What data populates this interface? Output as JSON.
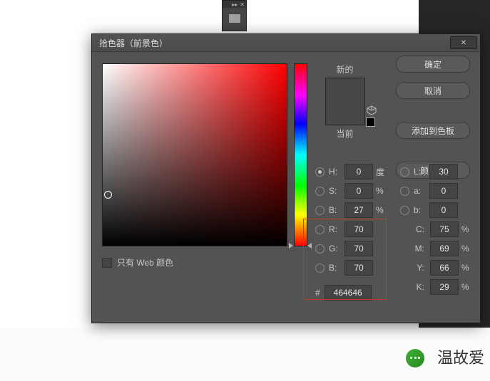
{
  "title": "拾色器（前景色）",
  "buttons": {
    "ok": "确定",
    "cancel": "取消",
    "add_swatch": "添加到色板",
    "library": "颜色库"
  },
  "labels": {
    "new": "新的",
    "current": "当前",
    "web_only": "只有 Web 颜色",
    "hash": "#"
  },
  "units": {
    "deg": "度",
    "pct": "%"
  },
  "hsb": {
    "h_label": "H:",
    "s_label": "S:",
    "b_label": "B:",
    "h": "0",
    "s": "0",
    "b": "27"
  },
  "lab": {
    "l_label": "L:",
    "a_label": "a:",
    "b_label": "b:",
    "l": "30",
    "a": "0",
    "b": "0"
  },
  "rgb": {
    "r_label": "R:",
    "g_label": "G:",
    "b_label": "B:",
    "r": "70",
    "g": "70",
    "b": "70"
  },
  "cmyk": {
    "c_label": "C:",
    "m_label": "M:",
    "y_label": "Y:",
    "k_label": "K:",
    "c": "75",
    "m": "69",
    "y": "66",
    "k": "29"
  },
  "hex": "464646",
  "footer": "温故爱"
}
